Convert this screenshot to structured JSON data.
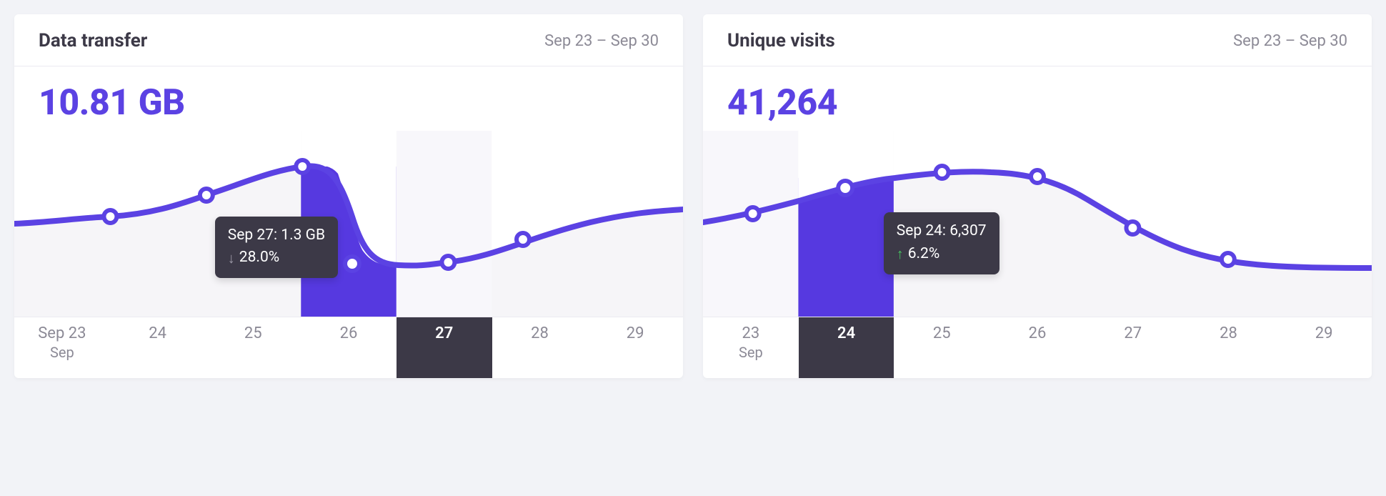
{
  "cards": [
    {
      "id": "data-transfer",
      "title": "Data transfer",
      "date_range": "Sep 23 – Sep 30",
      "value": "10.81 GB",
      "xaxis_month": "Sep",
      "highlight_index": 4,
      "tooltip": {
        "line1": "Sep 27: 1.3 GB",
        "direction": "down",
        "pct": "28.0%"
      }
    },
    {
      "id": "unique-visits",
      "title": "Unique visits",
      "date_range": "Sep 23 – Sep 30",
      "value": "41,264",
      "xaxis_month": "Sep",
      "highlight_index": 1,
      "tooltip": {
        "line1": "Sep 24: 6,307",
        "direction": "up",
        "pct": "6.2%"
      }
    }
  ],
  "chart_data": [
    {
      "type": "line",
      "title": "Data transfer",
      "unit": "GB",
      "total_label": "10.81 GB",
      "xlabel": "Sep",
      "x": [
        "Sep 23",
        "Sep 24",
        "Sep 25",
        "Sep 26",
        "Sep 27",
        "Sep 28",
        "Sep 29"
      ],
      "values": [
        1.65,
        1.75,
        1.9,
        2.05,
        1.3,
        1.36,
        1.8
      ],
      "selected": {
        "x": "Sep 27",
        "value_label": "1.3 GB",
        "value": 1.3,
        "change_pct": -28.0
      }
    },
    {
      "type": "line",
      "title": "Unique visits",
      "unit": "visits",
      "total_label": "41,264",
      "xlabel": "Sep",
      "x": [
        "Sep 23",
        "Sep 24",
        "Sep 25",
        "Sep 26",
        "Sep 27",
        "Sep 28",
        "Sep 29"
      ],
      "values": [
        5940,
        6307,
        6650,
        6680,
        5960,
        5170,
        4560
      ],
      "selected": {
        "x": "Sep 24",
        "value_label": "6,307",
        "value": 6307,
        "change_pct": 6.2
      }
    }
  ]
}
